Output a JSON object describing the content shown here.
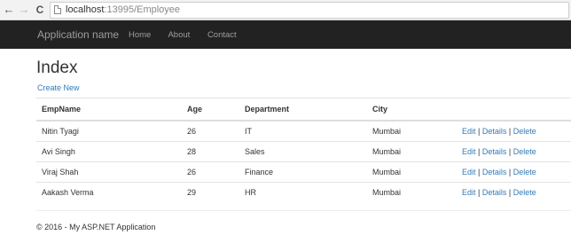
{
  "browser": {
    "url_host": "localhost",
    "url_path": ":13995/Employee"
  },
  "navbar": {
    "brand": "Application name",
    "links": [
      "Home",
      "About",
      "Contact"
    ]
  },
  "page": {
    "title": "Index",
    "create_link": "Create New"
  },
  "table": {
    "headers": [
      "EmpName",
      "Age",
      "Department",
      "City"
    ],
    "rows": [
      {
        "name": "Nitin Tyagi",
        "age": "26",
        "department": "IT",
        "city": "Mumbai"
      },
      {
        "name": "Avi Singh",
        "age": "28",
        "department": "Sales",
        "city": "Mumbai"
      },
      {
        "name": "Viraj Shah",
        "age": "26",
        "department": "Finance",
        "city": "Mumbai"
      },
      {
        "name": "Aakash Verma",
        "age": "29",
        "department": "HR",
        "city": "Mumbai"
      }
    ],
    "actions": {
      "edit": "Edit",
      "details": "Details",
      "delete": "Delete",
      "separator": "|"
    }
  },
  "footer": {
    "text": "© 2016 - My ASP.NET Application"
  },
  "colors": {
    "navbar_bg": "#222222",
    "link": "#337ab7"
  }
}
